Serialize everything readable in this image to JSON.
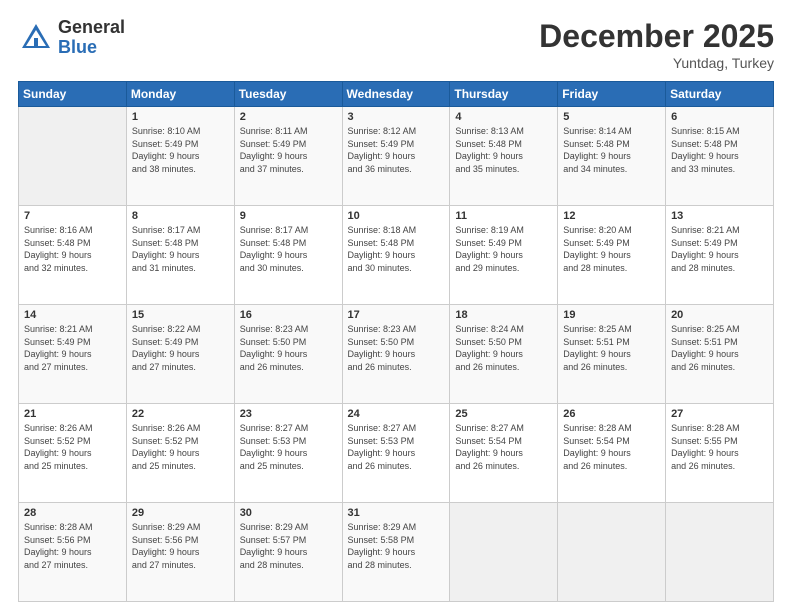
{
  "header": {
    "logo_general": "General",
    "logo_blue": "Blue",
    "month_title": "December 2025",
    "location": "Yuntdag, Turkey"
  },
  "weekdays": [
    "Sunday",
    "Monday",
    "Tuesday",
    "Wednesday",
    "Thursday",
    "Friday",
    "Saturday"
  ],
  "weeks": [
    [
      {
        "day": "",
        "info": ""
      },
      {
        "day": "1",
        "info": "Sunrise: 8:10 AM\nSunset: 5:49 PM\nDaylight: 9 hours\nand 38 minutes."
      },
      {
        "day": "2",
        "info": "Sunrise: 8:11 AM\nSunset: 5:49 PM\nDaylight: 9 hours\nand 37 minutes."
      },
      {
        "day": "3",
        "info": "Sunrise: 8:12 AM\nSunset: 5:49 PM\nDaylight: 9 hours\nand 36 minutes."
      },
      {
        "day": "4",
        "info": "Sunrise: 8:13 AM\nSunset: 5:48 PM\nDaylight: 9 hours\nand 35 minutes."
      },
      {
        "day": "5",
        "info": "Sunrise: 8:14 AM\nSunset: 5:48 PM\nDaylight: 9 hours\nand 34 minutes."
      },
      {
        "day": "6",
        "info": "Sunrise: 8:15 AM\nSunset: 5:48 PM\nDaylight: 9 hours\nand 33 minutes."
      }
    ],
    [
      {
        "day": "7",
        "info": "Sunrise: 8:16 AM\nSunset: 5:48 PM\nDaylight: 9 hours\nand 32 minutes."
      },
      {
        "day": "8",
        "info": "Sunrise: 8:17 AM\nSunset: 5:48 PM\nDaylight: 9 hours\nand 31 minutes."
      },
      {
        "day": "9",
        "info": "Sunrise: 8:17 AM\nSunset: 5:48 PM\nDaylight: 9 hours\nand 30 minutes."
      },
      {
        "day": "10",
        "info": "Sunrise: 8:18 AM\nSunset: 5:48 PM\nDaylight: 9 hours\nand 30 minutes."
      },
      {
        "day": "11",
        "info": "Sunrise: 8:19 AM\nSunset: 5:49 PM\nDaylight: 9 hours\nand 29 minutes."
      },
      {
        "day": "12",
        "info": "Sunrise: 8:20 AM\nSunset: 5:49 PM\nDaylight: 9 hours\nand 28 minutes."
      },
      {
        "day": "13",
        "info": "Sunrise: 8:21 AM\nSunset: 5:49 PM\nDaylight: 9 hours\nand 28 minutes."
      }
    ],
    [
      {
        "day": "14",
        "info": "Sunrise: 8:21 AM\nSunset: 5:49 PM\nDaylight: 9 hours\nand 27 minutes."
      },
      {
        "day": "15",
        "info": "Sunrise: 8:22 AM\nSunset: 5:49 PM\nDaylight: 9 hours\nand 27 minutes."
      },
      {
        "day": "16",
        "info": "Sunrise: 8:23 AM\nSunset: 5:50 PM\nDaylight: 9 hours\nand 26 minutes."
      },
      {
        "day": "17",
        "info": "Sunrise: 8:23 AM\nSunset: 5:50 PM\nDaylight: 9 hours\nand 26 minutes."
      },
      {
        "day": "18",
        "info": "Sunrise: 8:24 AM\nSunset: 5:50 PM\nDaylight: 9 hours\nand 26 minutes."
      },
      {
        "day": "19",
        "info": "Sunrise: 8:25 AM\nSunset: 5:51 PM\nDaylight: 9 hours\nand 26 minutes."
      },
      {
        "day": "20",
        "info": "Sunrise: 8:25 AM\nSunset: 5:51 PM\nDaylight: 9 hours\nand 26 minutes."
      }
    ],
    [
      {
        "day": "21",
        "info": "Sunrise: 8:26 AM\nSunset: 5:52 PM\nDaylight: 9 hours\nand 25 minutes."
      },
      {
        "day": "22",
        "info": "Sunrise: 8:26 AM\nSunset: 5:52 PM\nDaylight: 9 hours\nand 25 minutes."
      },
      {
        "day": "23",
        "info": "Sunrise: 8:27 AM\nSunset: 5:53 PM\nDaylight: 9 hours\nand 25 minutes."
      },
      {
        "day": "24",
        "info": "Sunrise: 8:27 AM\nSunset: 5:53 PM\nDaylight: 9 hours\nand 26 minutes."
      },
      {
        "day": "25",
        "info": "Sunrise: 8:27 AM\nSunset: 5:54 PM\nDaylight: 9 hours\nand 26 minutes."
      },
      {
        "day": "26",
        "info": "Sunrise: 8:28 AM\nSunset: 5:54 PM\nDaylight: 9 hours\nand 26 minutes."
      },
      {
        "day": "27",
        "info": "Sunrise: 8:28 AM\nSunset: 5:55 PM\nDaylight: 9 hours\nand 26 minutes."
      }
    ],
    [
      {
        "day": "28",
        "info": "Sunrise: 8:28 AM\nSunset: 5:56 PM\nDaylight: 9 hours\nand 27 minutes."
      },
      {
        "day": "29",
        "info": "Sunrise: 8:29 AM\nSunset: 5:56 PM\nDaylight: 9 hours\nand 27 minutes."
      },
      {
        "day": "30",
        "info": "Sunrise: 8:29 AM\nSunset: 5:57 PM\nDaylight: 9 hours\nand 28 minutes."
      },
      {
        "day": "31",
        "info": "Sunrise: 8:29 AM\nSunset: 5:58 PM\nDaylight: 9 hours\nand 28 minutes."
      },
      {
        "day": "",
        "info": ""
      },
      {
        "day": "",
        "info": ""
      },
      {
        "day": "",
        "info": ""
      }
    ]
  ]
}
